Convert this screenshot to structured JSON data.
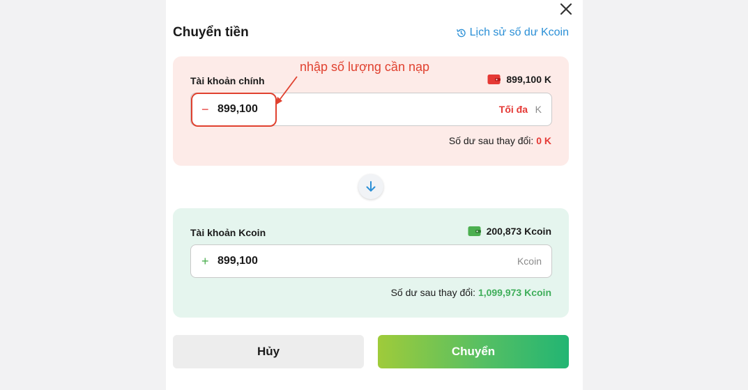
{
  "modal": {
    "title": "Chuyển tiền",
    "history_link": "Lịch sử số dư Kcoin",
    "close_icon": "close-icon"
  },
  "main_account": {
    "label": "Tài khoản chính",
    "balance": "899,100 K",
    "amount": "899,100",
    "sign": "−",
    "max_label": "Tối đa",
    "unit": "K",
    "after_label": "Số dư sau thay đổi:",
    "after_value": "0 K",
    "wallet_color": "#e53935"
  },
  "annotation": {
    "text": "nhập số lượng cần nạp",
    "color": "#e0412f"
  },
  "swap": {
    "icon": "arrow-down-icon"
  },
  "kcoin_account": {
    "label": "Tài khoản Kcoin",
    "balance": "200,873 Kcoin",
    "amount": "899,100",
    "sign": "+",
    "unit": "Kcoin",
    "after_label": "Số dư sau thay đổi:",
    "after_value": "1,099,973 Kcoin",
    "wallet_color": "#4caf50"
  },
  "actions": {
    "cancel_label": "Hủy",
    "submit_label": "Chuyển"
  },
  "colors": {
    "accent_blue": "#2a8fd6",
    "main_card_bg": "#fdebe8",
    "kcoin_card_bg": "#e5f5ee",
    "danger": "#e53935",
    "success": "#3fae5a"
  }
}
